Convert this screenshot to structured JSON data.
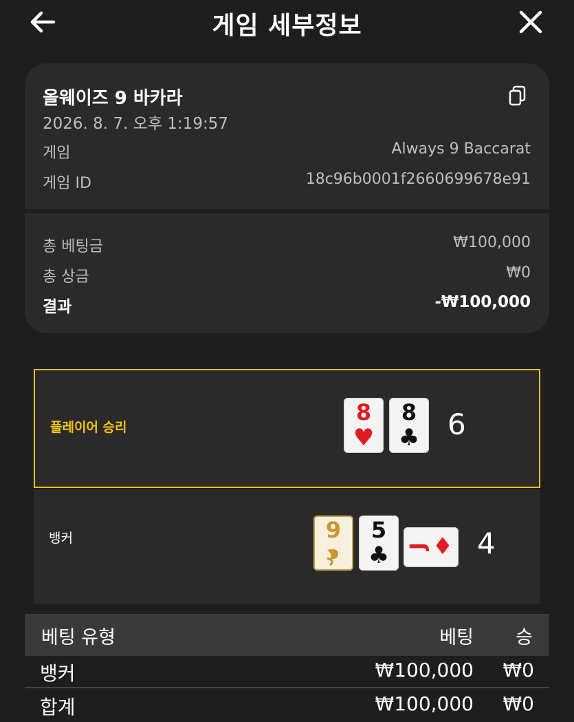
{
  "header": {
    "title": "게임 세부정보",
    "back_icon": "arrow-left-icon",
    "close_icon": "close-icon"
  },
  "summary": {
    "game_name": "올웨이즈 9 바카라",
    "timestamp": "2026. 8. 7. 오후 1:19:57",
    "copy_icon": "copy-icon",
    "rows": [
      {
        "label": "게임",
        "value": "Always 9 Baccarat"
      },
      {
        "label": "게임 ID",
        "value": "18c96b0001f2660699678e91"
      }
    ],
    "totals": [
      {
        "label": "총 베팅금",
        "value": "₩100,000"
      },
      {
        "label": "총 상금",
        "value": "₩0"
      },
      {
        "label": "결과",
        "value": "-₩100,000"
      }
    ]
  },
  "result": {
    "player": {
      "label": "플레이어 승리",
      "score": "6",
      "cards": [
        {
          "rank": "8",
          "suit": "♥",
          "color": "red"
        },
        {
          "rank": "8",
          "suit": "♣",
          "color": "black"
        }
      ]
    },
    "banker": {
      "label": "뱅커",
      "score": "4",
      "cards": [
        {
          "rank": "9",
          "suit": "special",
          "color": "gold"
        },
        {
          "rank": "5",
          "suit": "♣",
          "color": "black"
        },
        {
          "rank": "J",
          "suit": "♦",
          "color": "red",
          "rotated": true
        }
      ]
    },
    "accent_color": "#e9c21e"
  },
  "bets_table": {
    "headers": {
      "type": "베팅 유형",
      "bet": "베팅",
      "win": "승"
    },
    "rows": [
      {
        "type": "뱅커",
        "bet": "₩100,000",
        "win": "₩0"
      }
    ],
    "total": {
      "type": "합계",
      "bet": "₩100,000",
      "win": "₩0"
    }
  }
}
